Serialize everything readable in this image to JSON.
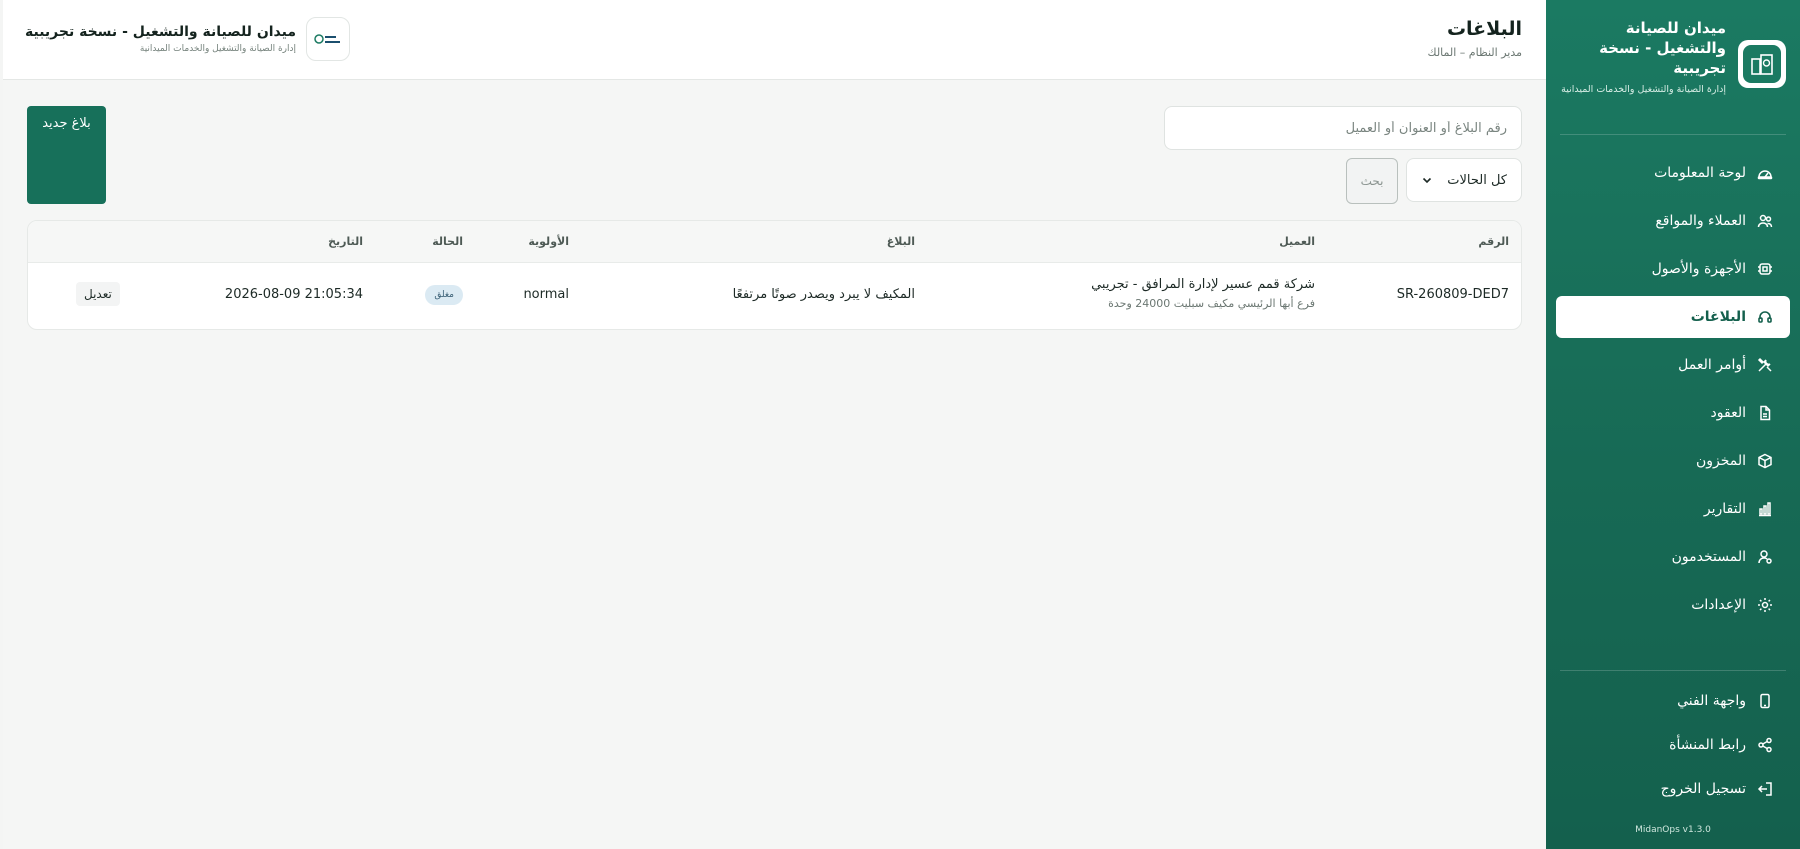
{
  "sidebar": {
    "brand_title": "ميدان للصيانة والتشغيل - نسخة تجريبية",
    "brand_subtitle": "إدارة الصيانة والتشغيل والخدمات الميدانية",
    "items": [
      {
        "label": "لوحة المعلومات",
        "icon": "dashboard-icon"
      },
      {
        "label": "العملاء والمواقع",
        "icon": "users-icon"
      },
      {
        "label": "الأجهزة والأصول",
        "icon": "chip-icon"
      },
      {
        "label": "البلاغات",
        "icon": "headset-icon",
        "active": true
      },
      {
        "label": "أوامر العمل",
        "icon": "tools-icon"
      },
      {
        "label": "العقود",
        "icon": "document-icon"
      },
      {
        "label": "المخزون",
        "icon": "box-icon"
      },
      {
        "label": "التقارير",
        "icon": "bar-chart-icon"
      },
      {
        "label": "المستخدمون",
        "icon": "user-icon"
      },
      {
        "label": "الإعدادات",
        "icon": "gear-icon"
      }
    ],
    "bottom_items": [
      {
        "label": "واجهة الفني",
        "icon": "phone-icon"
      },
      {
        "label": "رابط المنشأة",
        "icon": "share-icon"
      },
      {
        "label": "تسجيل الخروج",
        "icon": "logout-icon"
      }
    ],
    "version": "MidanOps v1.3.0"
  },
  "header": {
    "title": "البلاغات",
    "subtitle": "مدير النظام – المالك",
    "brand_title": "ميدان للصيانة والتشغيل - نسخة تجريبية",
    "brand_subtitle": "إدارة الصيانة والتشغيل والخدمات الميدانية"
  },
  "toolbar": {
    "search_placeholder": "رقم البلاغ أو العنوان أو العميل",
    "status_selected": "كل الحالات",
    "search_label": "بحث",
    "new_label": "بلاغ جديد"
  },
  "table": {
    "headers": {
      "number": "الرقم",
      "client": "العميل",
      "issue": "البلاغ",
      "priority": "الأولوية",
      "status": "الحالة",
      "date": "التاريخ"
    },
    "rows": [
      {
        "number": "SR-260809-DED7",
        "client": "شركة قمم عسير لإدارة المرافق - تجريبي",
        "client_sub": "فرع أبها الرئيسي مكيف سبليت 24000 وحدة",
        "issue": "المكيف لا يبرد ويصدر صوتًا مرتفعًا",
        "priority": "normal",
        "status": "مغلق",
        "date": "2026-08-09 21:05:34",
        "edit_label": "تعديل"
      }
    ]
  },
  "colors": {
    "brand": "#1b7a62",
    "brand_dark": "#14604d",
    "status_closed_bg": "#dbeaf3"
  }
}
